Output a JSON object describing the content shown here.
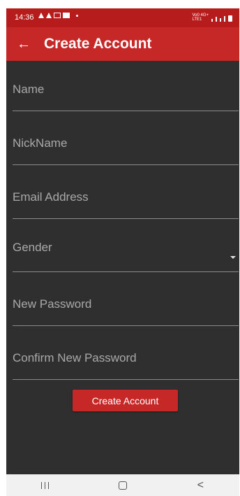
{
  "status_bar": {
    "time": "14:36",
    "network_text": "Vo0 4G+\nLTE1"
  },
  "app_bar": {
    "back_icon": "arrow-left",
    "title": "Create Account"
  },
  "form": {
    "name_placeholder": "Name",
    "nickname_placeholder": "NickName",
    "email_placeholder": "Email Address",
    "gender_placeholder": "Gender",
    "new_password_placeholder": "New Password",
    "confirm_password_placeholder": "Confirm New Password",
    "submit_label": "Create Account"
  },
  "colors": {
    "primary": "#c62828",
    "status_bar": "#b71c1c",
    "background": "#2f2f2f"
  },
  "nav_bar": {
    "recent_icon": "recent-apps-icon",
    "home_icon": "home-icon",
    "back_icon": "back-icon"
  }
}
